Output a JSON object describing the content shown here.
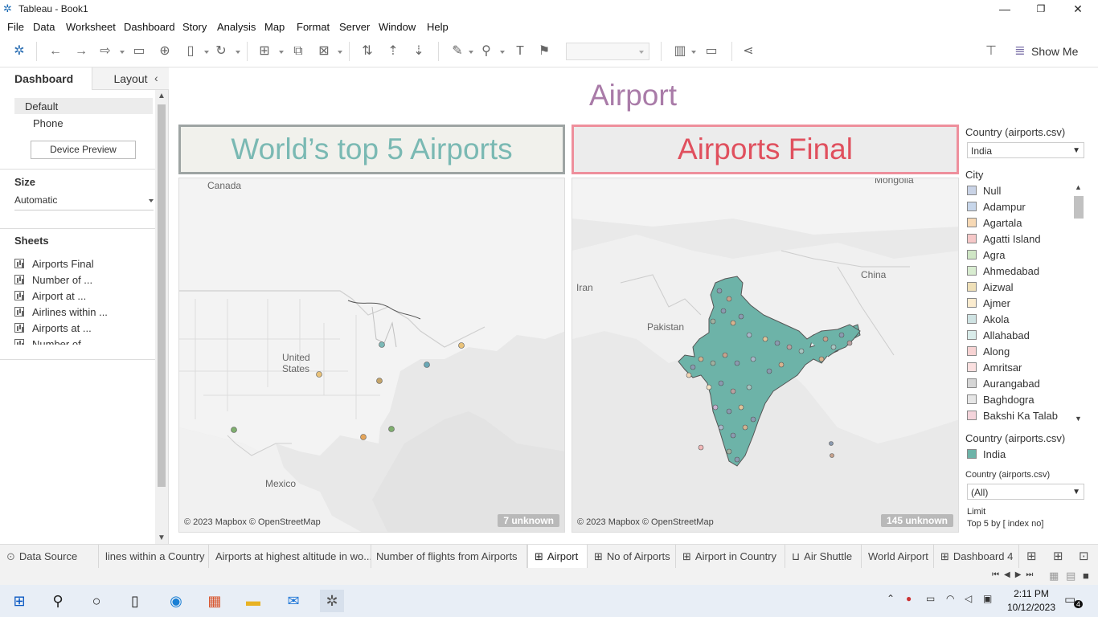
{
  "window": {
    "title": "Tableau - Book1",
    "min": "—",
    "max": "❐",
    "close": "✕"
  },
  "menu": [
    "File",
    "Data",
    "Worksheet",
    "Dashboard",
    "Story",
    "Analysis",
    "Map",
    "Format",
    "Server",
    "Window",
    "Help"
  ],
  "toolbar": {
    "show_me": "Show Me"
  },
  "left_pane": {
    "tabs": {
      "dashboard": "Dashboard",
      "layout": "Layout"
    },
    "devices": {
      "default": "Default",
      "phone": "Phone",
      "preview": "Device Preview"
    },
    "size": {
      "heading": "Size",
      "value": "Automatic"
    },
    "sheets": {
      "heading": "Sheets",
      "items": [
        "Airports Final",
        "Number of ...",
        "Airport at ...",
        "Airlines within ...",
        "Airports at ...",
        "Number of"
      ]
    }
  },
  "dashboard": {
    "title": "Airport",
    "left_map": {
      "title": "World’s top 5 Airports",
      "attribution": "© 2023 Mapbox © OpenStreetMap",
      "unknown": "7 unknown",
      "labels": {
        "canada": "Canada",
        "us1": "United",
        "us2": "States",
        "mexico": "Mexico"
      }
    },
    "right_map": {
      "title": "Airports Final",
      "attribution": "© 2023 Mapbox © OpenStreetMap",
      "unknown": "145 unknown",
      "labels": {
        "mongolia": "Mongolia",
        "iran": "Iran",
        "pakistan": "Pakistan",
        "china": "China"
      }
    }
  },
  "legends": {
    "country_filter": {
      "title": "Country (airports.csv)",
      "value": "India"
    },
    "city": {
      "title": "City",
      "items": [
        {
          "label": "Null",
          "color": "#c9d3e6"
        },
        {
          "label": "Adampur",
          "color": "#c7d6ea"
        },
        {
          "label": "Agartala",
          "color": "#f7d9b5"
        },
        {
          "label": "Agatti Island",
          "color": "#f6c8c8"
        },
        {
          "label": "Agra",
          "color": "#cfe6c5"
        },
        {
          "label": "Ahmedabad",
          "color": "#d8ecd0"
        },
        {
          "label": "Aizwal",
          "color": "#efe0b8"
        },
        {
          "label": "Ajmer",
          "color": "#fbeccf"
        },
        {
          "label": "Akola",
          "color": "#cfe3e3"
        },
        {
          "label": "Allahabad",
          "color": "#d9ecea"
        },
        {
          "label": "Along",
          "color": "#f7d3d3"
        },
        {
          "label": "Amritsar",
          "color": "#fbe0e0"
        },
        {
          "label": "Aurangabad",
          "color": "#d6d6d6"
        },
        {
          "label": "Baghdogra",
          "color": "#e6e6e6"
        },
        {
          "label": "Bakshi Ka Talab",
          "color": "#f4d4db"
        }
      ]
    },
    "country_color": {
      "title": "Country (airports.csv)",
      "label": "India",
      "color": "#6db3a8"
    },
    "country_filter2": {
      "title": "Country (airports.csv)",
      "value": "(All)"
    },
    "limit": {
      "title": "Limit",
      "value": "Top 5 by [ index no]"
    }
  },
  "tabs": [
    "Data Source",
    "lines within a Country",
    "Airports at highest altitude in wo...",
    "Number of flights from Airports",
    "Airport",
    "No of Airports",
    "Airport in  Country",
    "Air Shuttle",
    "World Airport",
    "Dashboard 4"
  ],
  "taskbar": {
    "time": "2:11 PM",
    "date": "10/12/2023",
    "notif": "4"
  },
  "colors": {
    "teal": "#6db3a8",
    "pink": "#ee8f9c",
    "title_purple": "#a97ba8",
    "left_title": "#7ab9b3",
    "right_title": "#e0505e"
  }
}
